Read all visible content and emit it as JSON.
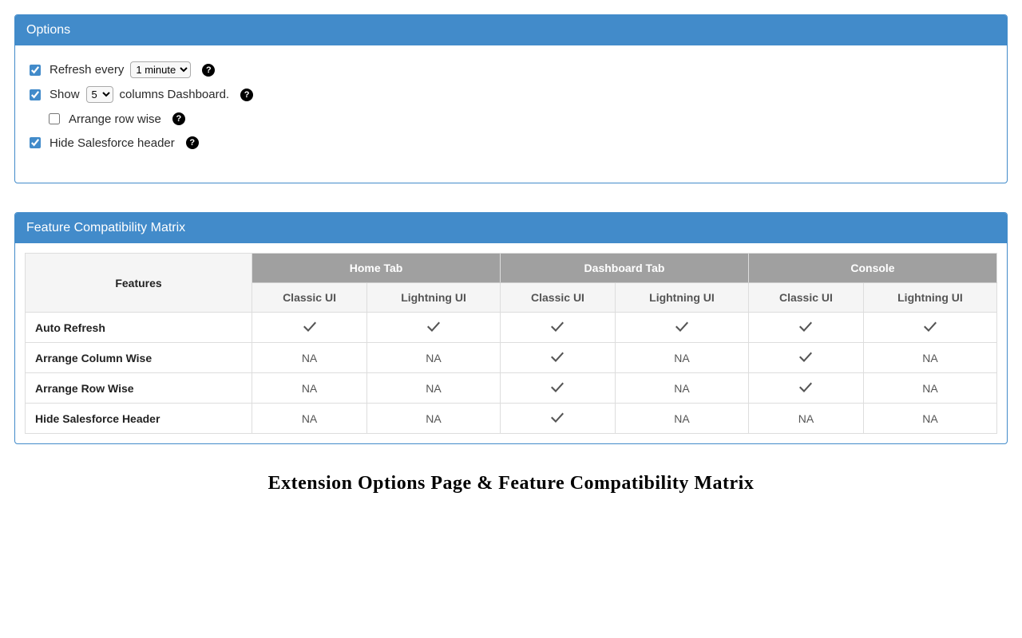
{
  "options_panel": {
    "title": "Options",
    "refresh": {
      "checked": true,
      "label_pre": "Refresh every",
      "selected": "1 minute"
    },
    "show_columns": {
      "checked": true,
      "label_pre": "Show",
      "selected": "5",
      "label_post": "columns Dashboard."
    },
    "arrange_row": {
      "checked": false,
      "label": "Arrange row wise"
    },
    "hide_header": {
      "checked": true,
      "label": "Hide Salesforce header"
    }
  },
  "matrix_panel": {
    "title": "Feature Compatibility Matrix",
    "headers": {
      "features": "Features",
      "groups": [
        "Home Tab",
        "Dashboard Tab",
        "Console"
      ],
      "subs": [
        "Classic UI",
        "Lightning UI",
        "Classic UI",
        "Lightning UI",
        "Classic UI",
        "Lightning UI"
      ]
    },
    "rows": [
      {
        "name": "Auto Refresh",
        "cells": [
          "check",
          "check",
          "check",
          "check",
          "check",
          "check"
        ]
      },
      {
        "name": "Arrange Column Wise",
        "cells": [
          "NA",
          "NA",
          "check",
          "NA",
          "check",
          "NA"
        ]
      },
      {
        "name": "Arrange Row Wise",
        "cells": [
          "NA",
          "NA",
          "check",
          "NA",
          "check",
          "NA"
        ]
      },
      {
        "name": "Hide Salesforce Header",
        "cells": [
          "NA",
          "NA",
          "check",
          "NA",
          "NA",
          "NA"
        ]
      }
    ]
  },
  "caption": "Extension Options Page & Feature Compatibility Matrix"
}
